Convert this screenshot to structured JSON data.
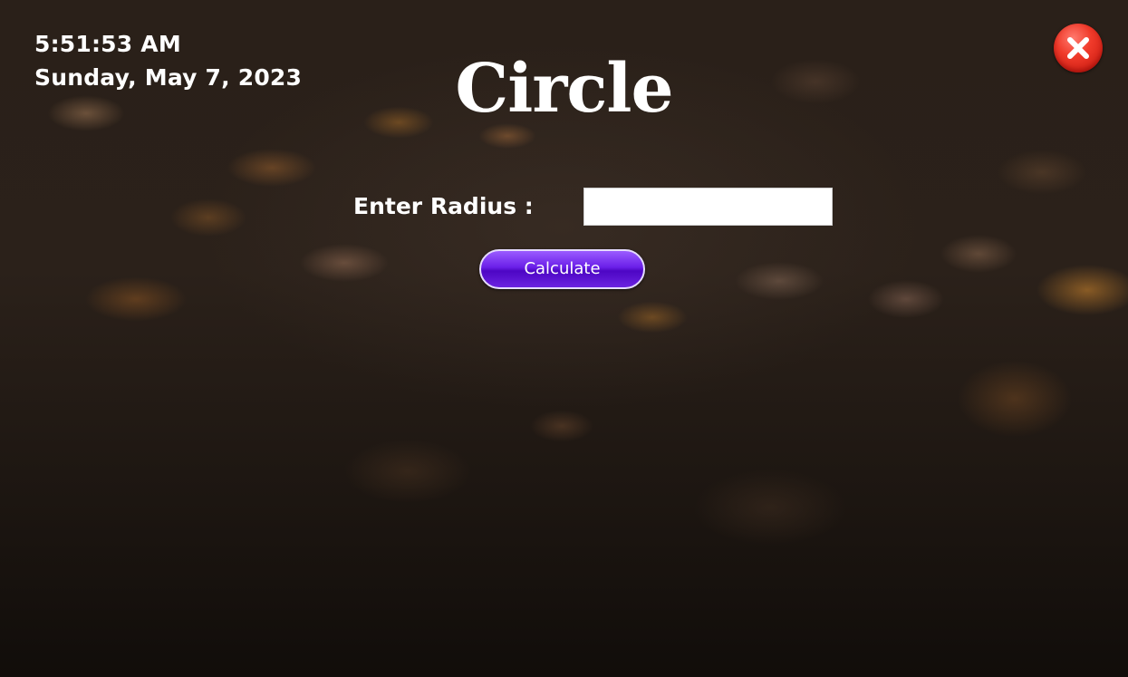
{
  "clock": {
    "time": "5:51:53 AM",
    "date": "Sunday, May 7, 2023"
  },
  "page": {
    "title": "Circle"
  },
  "form": {
    "radius_label": "Enter Radius :",
    "radius_value": "",
    "calculate_label": "Calculate"
  },
  "controls": {
    "close_icon": "close-x-icon",
    "close_color": "#e8281d",
    "button_color": "#6a1fe8"
  }
}
